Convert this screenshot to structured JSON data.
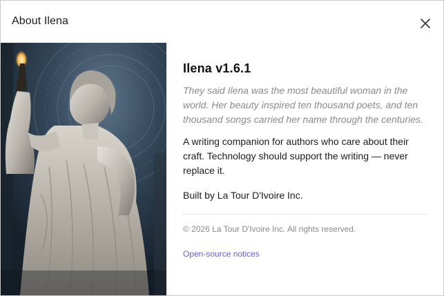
{
  "window": {
    "title": "About Ilena",
    "close_icon": "close-icon"
  },
  "artwork": {
    "subject": "statue-of-woman-holding-pen"
  },
  "about": {
    "app_name": "Ilena v1.6.1",
    "quote": "They said Ilena was the most beautiful woman in the world. Her beauty inspired ten thousand poets, and ten thousand songs carried her name through the centuries.",
    "description": "A writing companion for authors who care about their craft. Technology should support the writing — never replace it.",
    "built_by": "Built by La Tour D'Ivoire Inc.",
    "copyright": "© 2026 La Tour D'Ivoire Inc. All rights reserved.",
    "oss_link": "Open-source notices"
  },
  "colors": {
    "link": "#6a5ed1",
    "muted_text": "#8a8a8a",
    "primary_text": "#1b1b1b",
    "divider": "#e2e2e2"
  }
}
